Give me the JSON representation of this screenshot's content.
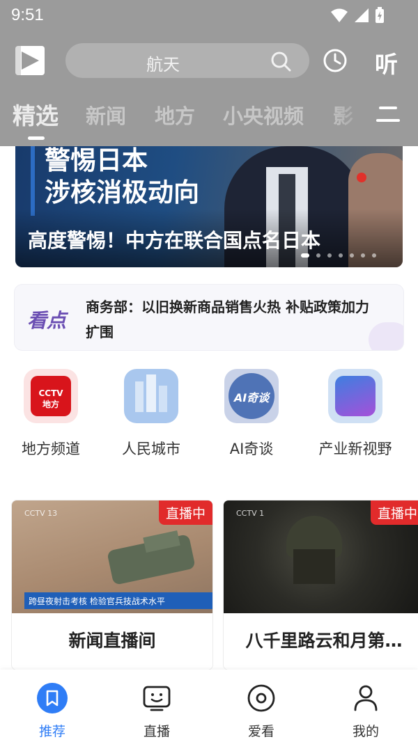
{
  "status_bar": {
    "time": "9:51"
  },
  "header": {
    "search_placeholder": "航天",
    "listen_label": "听",
    "tabs": [
      {
        "label": "精选",
        "active": true
      },
      {
        "label": "新闻"
      },
      {
        "label": "地方"
      },
      {
        "label": "小央视频"
      },
      {
        "label": "影"
      }
    ]
  },
  "banner": {
    "headline_line1": "警惕日本",
    "headline_line2": "涉核消极动向",
    "caption": "高度警惕！中方在联合国点名日本",
    "slide_count": 7,
    "active_slide": 1
  },
  "ticker": {
    "label": "看点",
    "text": "商务部：以旧换新商品销售火热 补贴政策加力扩围"
  },
  "quick_channels": [
    {
      "label": "地方频道",
      "icon": "cctv-local-icon"
    },
    {
      "label": "人民城市",
      "icon": "people-city-icon"
    },
    {
      "label": "AI奇谈",
      "icon": "ai-talk-icon"
    },
    {
      "label": "产业新视野",
      "icon": "industry-vision-icon"
    }
  ],
  "live_cards": [
    {
      "title": "新闻直播间",
      "badge": "直播中",
      "ticker_headline": "跨昼夜射击考核 检验官兵技战术水平"
    },
    {
      "title": "八千里路云和月第…",
      "badge": "直播中"
    }
  ],
  "bottom_nav": [
    {
      "label": "推荐",
      "active": true,
      "icon": "bookmark-icon"
    },
    {
      "label": "直播",
      "icon": "tv-face-icon"
    },
    {
      "label": "爱看",
      "icon": "eye-circle-icon"
    },
    {
      "label": "我的",
      "icon": "person-icon"
    }
  ],
  "colors": {
    "accent": "#2f7df6",
    "live_red": "#e12b2b",
    "header_grey": "#9b9b9b"
  }
}
